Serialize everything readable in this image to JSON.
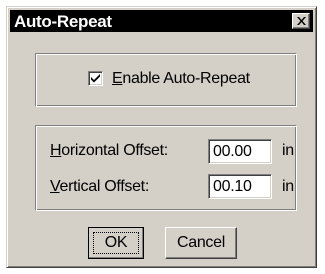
{
  "window": {
    "title": "Auto-Repeat",
    "close_icon": "close-x-icon"
  },
  "options": {
    "enable_label_prefix": "E",
    "enable_label_rest": "nable Auto-Repeat",
    "enable_checked": true
  },
  "offsets": {
    "horizontal_label_prefix": "H",
    "horizontal_label_rest": "orizontal Offset:",
    "horizontal_value": "00.00",
    "horizontal_unit": "in",
    "vertical_label_prefix": "V",
    "vertical_label_rest": "ertical Offset:",
    "vertical_value": "00.10",
    "vertical_unit": "in"
  },
  "buttons": {
    "ok_label": "OK",
    "cancel_label": "Cancel"
  }
}
